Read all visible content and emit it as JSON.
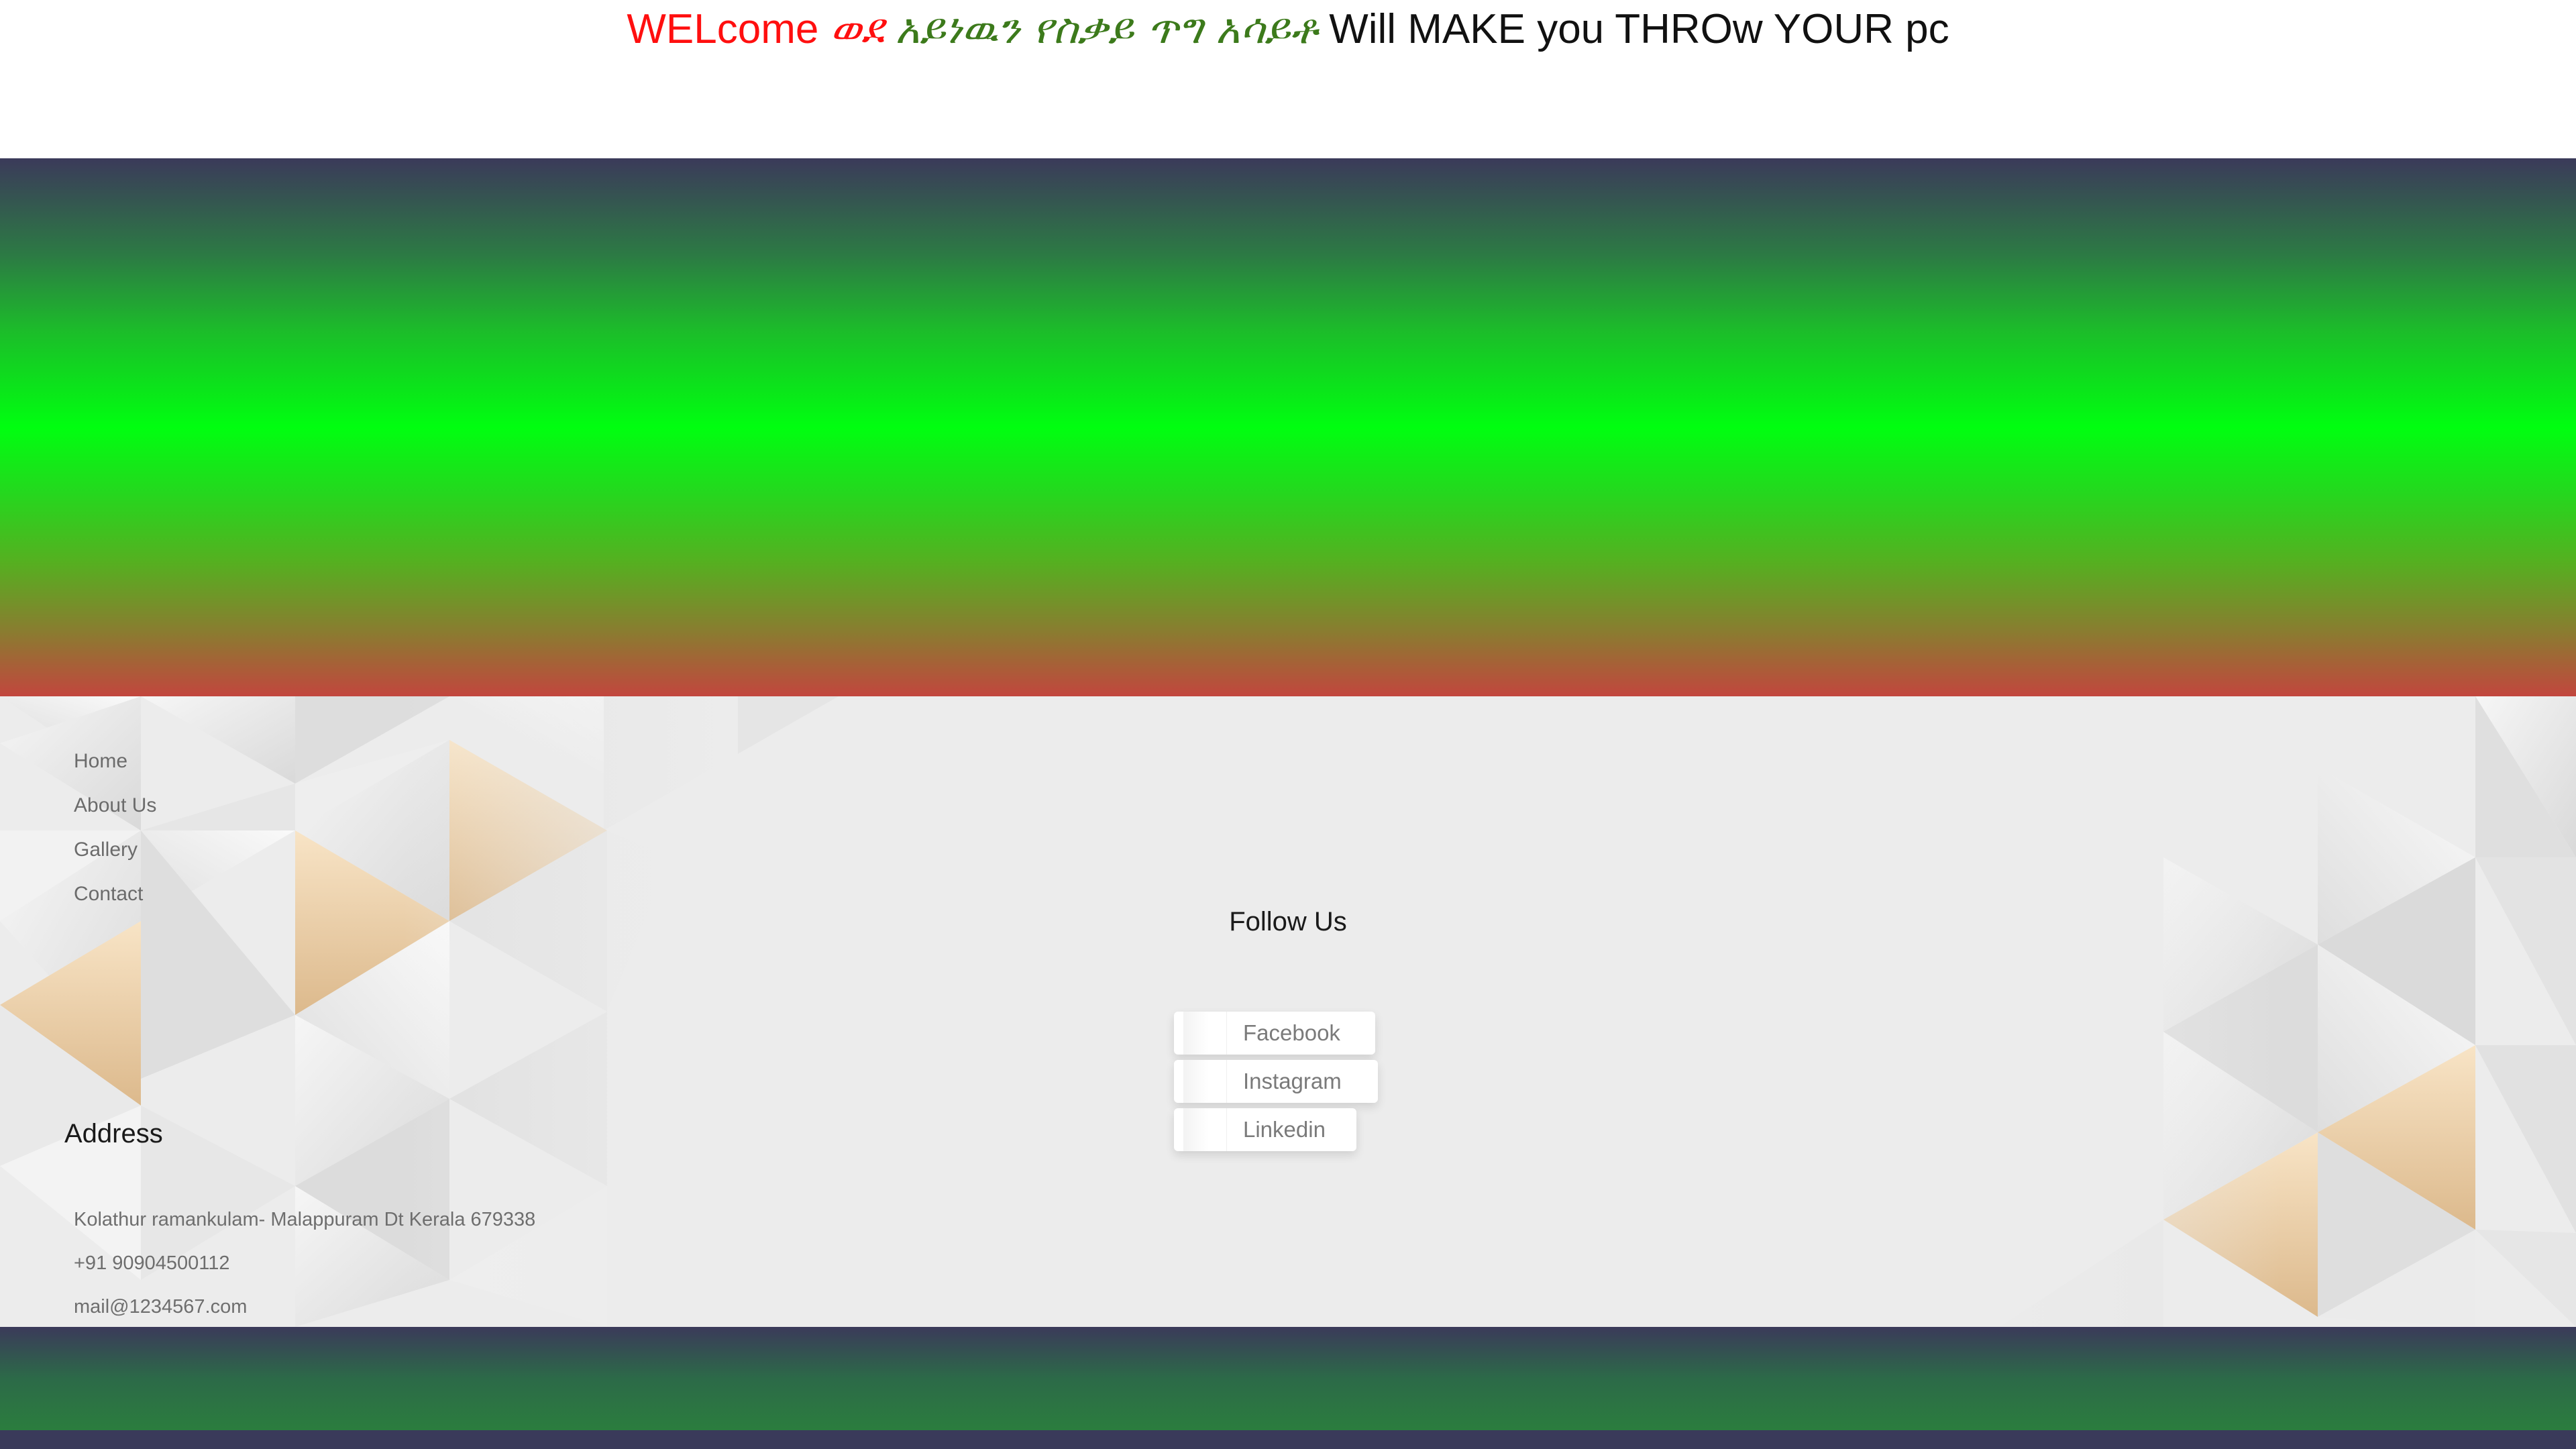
{
  "header": {
    "headline_part1": "WELcome",
    "headline_part2": "ወደ",
    "headline_part3": "አይነዉን የስቃይ ጥግ አሳይቶ",
    "headline_part4": "Will MAKE you THROw YOUR pc",
    "colors": {
      "part1": "#ff0f0f",
      "part2": "#ff0f0f",
      "part3": "#3c7a1b",
      "part4": "#111111"
    }
  },
  "hero": {
    "gradient_colors": [
      "#3b3a5a",
      "#00ff10",
      "#c2463e"
    ]
  },
  "footer": {
    "menu": [
      "Home",
      "About Us",
      "Gallery",
      "Contact"
    ],
    "address_title": "Address",
    "address_lines": [
      "Kolathur ramankulam- Malappuram Dt Kerala 679338",
      "+91 90904500112",
      "mail@1234567.com"
    ],
    "follow_title": "Follow Us",
    "social": [
      {
        "label": "Facebook",
        "icon": "facebook-icon"
      },
      {
        "label": "Instagram",
        "icon": "instagram-icon"
      },
      {
        "label": "Linkedin",
        "icon": "linkedin-icon"
      }
    ],
    "background_color": "#ececec",
    "accent_color": "#e8c9a0"
  }
}
